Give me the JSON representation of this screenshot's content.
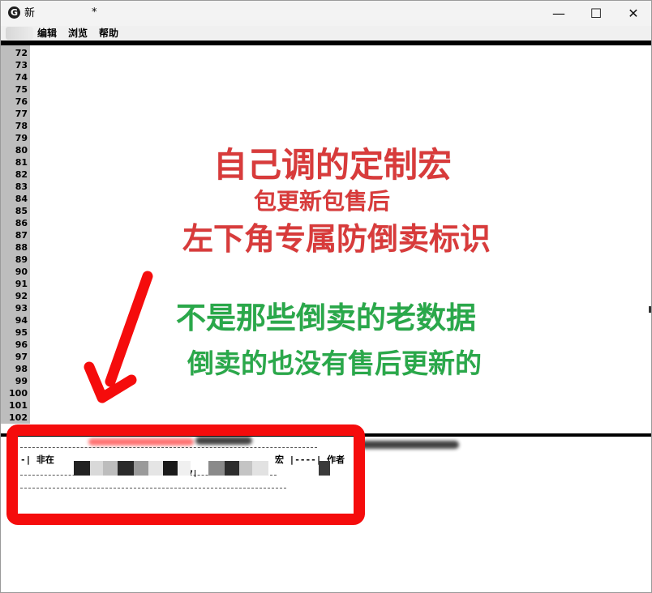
{
  "window": {
    "title_prefix": "新",
    "title_modified": "*",
    "controls": {
      "minimize": "—",
      "maximize": "☐",
      "close": "✕"
    },
    "app_icon_glyph": "G"
  },
  "menu": {
    "items": [
      "编辑",
      "浏览",
      "帮助"
    ]
  },
  "line_numbers": [
    "72",
    "73",
    "74",
    "75",
    "76",
    "77",
    "78",
    "79",
    "80",
    "81",
    "82",
    "83",
    "84",
    "85",
    "86",
    "87",
    "88",
    "89",
    "90",
    "91",
    "92",
    "93",
    "94",
    "95",
    "96",
    "97",
    "98",
    "99",
    "100",
    "101",
    "102"
  ],
  "promo": {
    "line1": "自己调的定制宏",
    "line2": "包更新包售后",
    "line3": "左下角专属防倒卖标识",
    "line4": "不是那些倒卖的老数据",
    "line5": "倒卖的也没有售后更新的",
    "colors": {
      "red": "#d83b3b",
      "green": "#2aa84a",
      "frame": "#f50c0c"
    }
  },
  "status": {
    "segment1": "-| 非在",
    "segment2": "宏 |----| 作者",
    "segment3": "+7|"
  }
}
